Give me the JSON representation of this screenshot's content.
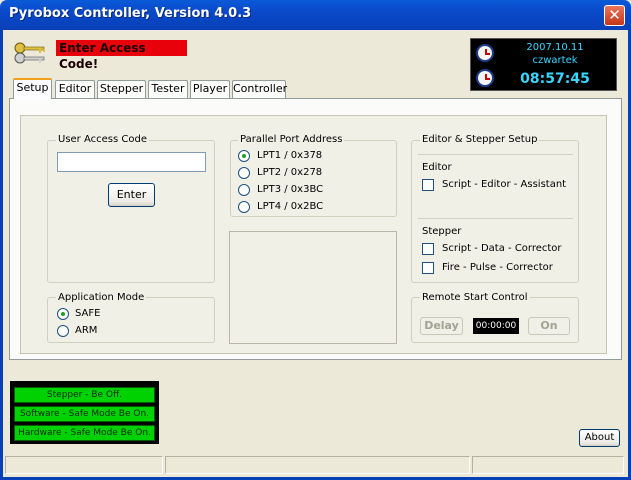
{
  "window": {
    "title": "Pyrobox Controller, Version 4.0.3",
    "close_glyph": "✕"
  },
  "header": {
    "access_message": "Enter Access Code!"
  },
  "clock": {
    "date": "2007.10.11",
    "day": "czwartek",
    "time": "08:57:45"
  },
  "tabs": [
    {
      "label": "Setup",
      "active": true
    },
    {
      "label": "Editor"
    },
    {
      "label": "Stepper"
    },
    {
      "label": "Tester"
    },
    {
      "label": "Player"
    },
    {
      "label": "Controller"
    }
  ],
  "user_access": {
    "group_label": "User Access Code",
    "value": "",
    "enter_label": "Enter"
  },
  "application_mode": {
    "group_label": "Application Mode",
    "options": [
      {
        "label": "SAFE",
        "selected": true
      },
      {
        "label": "ARM",
        "selected": false
      }
    ]
  },
  "parallel_port": {
    "group_label": "Parallel Port Address",
    "options": [
      {
        "label": "LPT1  /  0x378",
        "selected": true
      },
      {
        "label": "LPT2  /  0x278",
        "selected": false
      },
      {
        "label": "LPT3  /  0x3BC",
        "selected": false
      },
      {
        "label": "LPT4  /  0x2BC",
        "selected": false
      }
    ]
  },
  "editor_stepper_setup": {
    "group_label": "Editor & Stepper Setup",
    "editor_label": "Editor",
    "editor_options": [
      {
        "label": "Script - Editor - Assistant",
        "checked": false
      }
    ],
    "stepper_label": "Stepper",
    "stepper_options": [
      {
        "label": "Script - Data - Corrector",
        "checked": false
      },
      {
        "label": "Fire - Pulse - Corrector",
        "checked": false
      }
    ]
  },
  "remote_start": {
    "group_label": "Remote Start Control",
    "delay_label": "Delay",
    "timer": "00:00:00",
    "on_label": "On"
  },
  "status_leds": [
    {
      "label": "Stepper - Be Off."
    },
    {
      "label": "Software - Safe Mode Be On."
    },
    {
      "label": "Hardware - Safe Mode Be On."
    }
  ],
  "about_label": "About",
  "colors": {
    "led_green": "#00d100",
    "alert_red": "#e8000a",
    "clock_cyan": "#3ad6ff",
    "title_blue": "#0a49c9"
  }
}
